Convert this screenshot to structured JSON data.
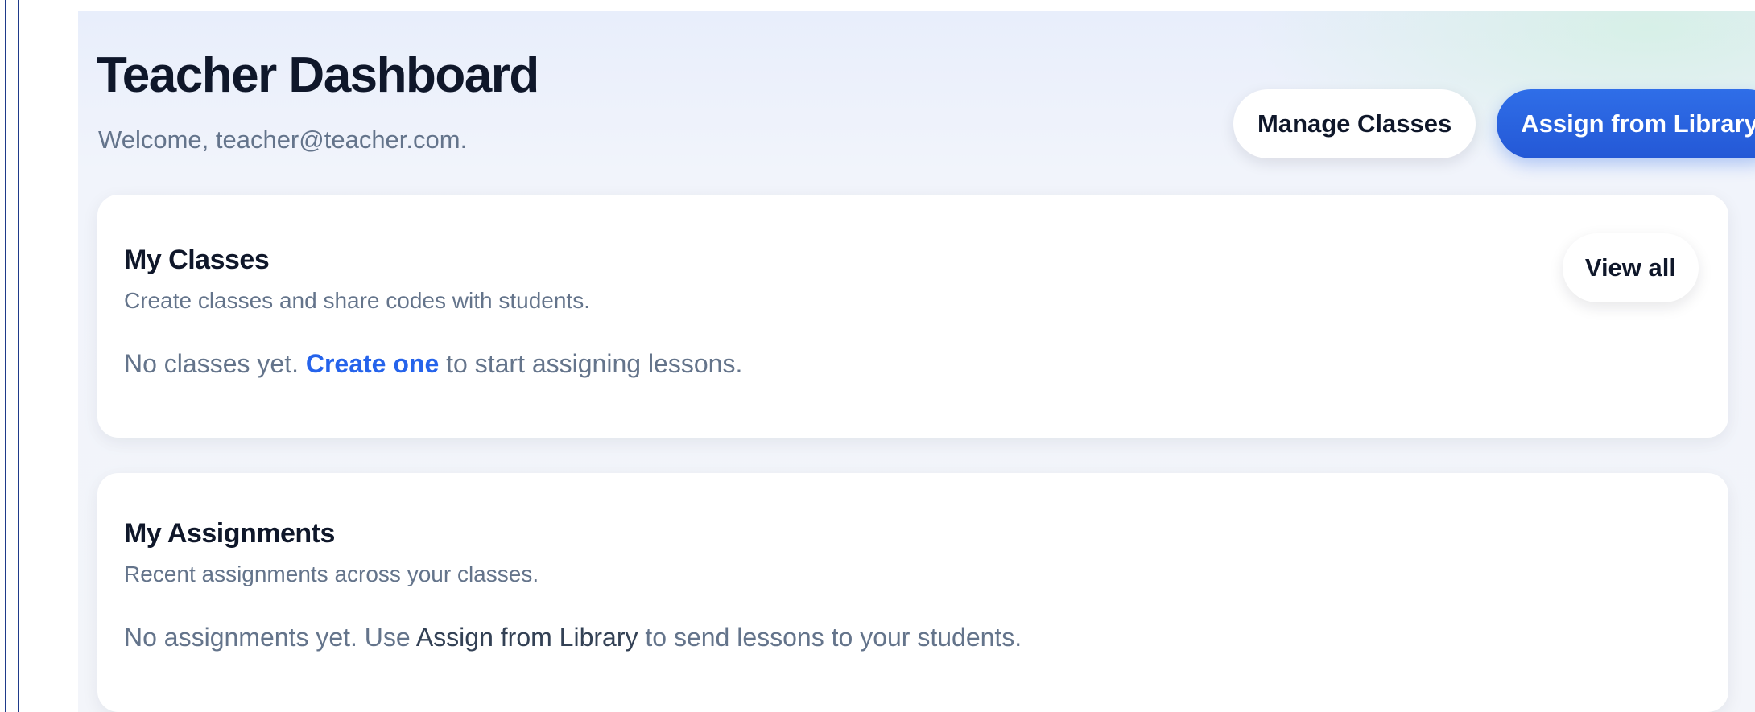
{
  "header": {
    "title": "Teacher Dashboard",
    "welcome": "Welcome, teacher@teacher.com.",
    "manage_classes_label": "Manage Classes",
    "assign_library_label": "Assign from Library"
  },
  "classes_card": {
    "title": "My Classes",
    "description": "Create classes and share codes with students.",
    "view_all_label": "View all",
    "empty_prefix": "No classes yet. ",
    "empty_link": "Create one",
    "empty_suffix": " to start assigning lessons."
  },
  "assignments_card": {
    "title": "My Assignments",
    "description": "Recent assignments across your classes.",
    "empty_prefix": "No assignments yet. Use ",
    "empty_emphasis": "Assign from Library",
    "empty_suffix": " to send lessons to your students."
  },
  "colors": {
    "primary": "#2563eb",
    "title_text": "#0f172a",
    "muted_text": "#64748b",
    "frame_lines": "#1f3a8a"
  }
}
